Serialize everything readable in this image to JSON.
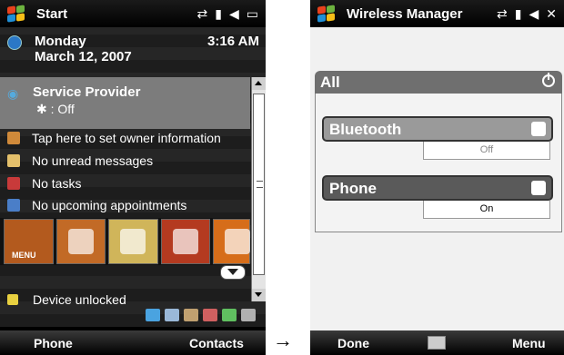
{
  "left": {
    "titlebar": {
      "title": "Start",
      "icons": [
        "sync-icon",
        "signal-icon",
        "volume-icon",
        "battery-icon"
      ]
    },
    "date": {
      "day": "Monday",
      "date": "March 12, 2007",
      "time": "3:16 AM"
    },
    "provider": {
      "name": "Service Provider",
      "bluetooth_status": ": Off"
    },
    "items": [
      {
        "label": "Tap here to set owner information",
        "icon": "person-icon"
      },
      {
        "label": "No unread messages",
        "icon": "envelope-icon"
      },
      {
        "label": "No tasks",
        "icon": "tasks-icon"
      },
      {
        "label": "No upcoming appointments",
        "icon": "calendar-icon"
      }
    ],
    "launcher": {
      "menu_label": "MENU"
    },
    "device": "Device unlocked",
    "softkeys": {
      "left": "Phone",
      "right": "Contacts"
    },
    "colors": {
      "provider_bg": "#7c7c7c"
    }
  },
  "right": {
    "titlebar": {
      "title": "Wireless Manager",
      "icons": [
        "sync-icon",
        "signal-icon",
        "volume-icon",
        "close-icon"
      ]
    },
    "all_label": "All",
    "bluetooth": {
      "label": "Bluetooth",
      "state": "Off"
    },
    "phone": {
      "label": "Phone",
      "state": "On"
    },
    "softkeys": {
      "left": "Done",
      "right": "Menu"
    }
  },
  "arrow": "→"
}
